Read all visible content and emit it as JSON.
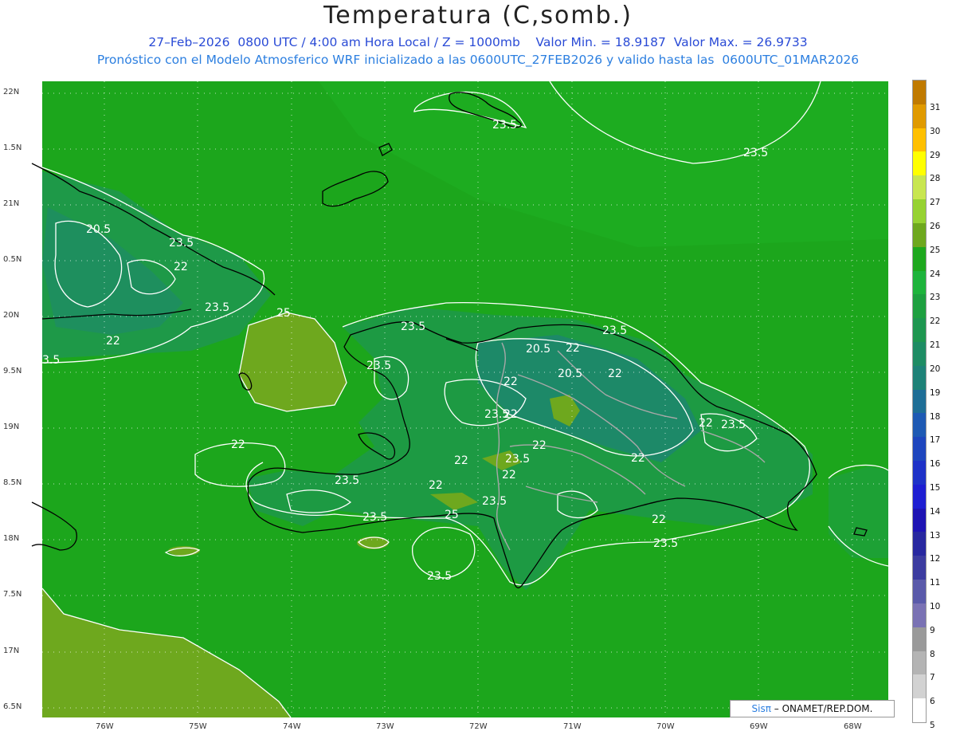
{
  "title": "Temperatura (C,somb.)",
  "subtitle1": "27–Feb–2026  0800 UTC / 4:00 am Hora Local / Z = 1000mb    Valor Min. = 18.9187  Valor Max. = 26.9733",
  "subtitle2": "Pronóstico con el Modelo Atmosferico WRF inicializado a las 0600UTC_27FEB2026 y valido hasta las  0600UTC_01MAR2026",
  "lat_labels": [
    "22N",
    "1.5N",
    "21N",
    "0.5N",
    "20N",
    "9.5N",
    "19N",
    "8.5N",
    "18N",
    "7.5N",
    "17N",
    "6.5N"
  ],
  "lon_labels": [
    "76W",
    "75W",
    "74W",
    "73W",
    "72W",
    "71W",
    "70W",
    "69W",
    "68W"
  ],
  "colorbar": {
    "levels": [
      "31",
      "30",
      "29",
      "28",
      "27",
      "26",
      "25",
      "24",
      "23",
      "22",
      "21",
      "20",
      "19",
      "18",
      "17",
      "16",
      "15",
      "14",
      "13",
      "12",
      "11",
      "10",
      "9",
      "8",
      "7",
      "6",
      "5"
    ],
    "colors": [
      "#c07a00",
      "#e09a00",
      "#ffc000",
      "#ffff00",
      "#c8e650",
      "#96d232",
      "#6ea81e",
      "#1ea81e",
      "#1eb43c",
      "#1ea040",
      "#1e9650",
      "#1e8c64",
      "#1e8278",
      "#1e6e96",
      "#1e5ab4",
      "#1e46be",
      "#1e32c8",
      "#1e1ed2",
      "#1e14b4",
      "#2828a0",
      "#3c3ca0",
      "#5a5aaa",
      "#7a72b4",
      "#9a9a9a",
      "#b4b4b4",
      "#d2d2d2",
      "#ffffff"
    ]
  },
  "contour_labels": [
    "23.5",
    "23.5",
    "20.5",
    "23.5",
    "22",
    "23.5",
    "22",
    "25",
    "3.5",
    "23.5",
    "23.5",
    "20.5",
    "22",
    "23.5",
    "20.5",
    "22",
    "22",
    "22",
    "23.5",
    "22",
    "23.5",
    "22",
    "23.5",
    "22",
    "22",
    "22",
    "23.5",
    "22",
    "23.5",
    "22",
    "23.5",
    "23.5",
    "23.5",
    "22",
    "25",
    "23.5",
    "23.5",
    "23.5"
  ],
  "credit": {
    "brand": "Sisπ",
    "text": " – ONAMET/REP.DOM."
  },
  "colors": {
    "sea": "#1ca61c",
    "warm": "#6ea81e",
    "cool": "#1e9650",
    "coast": "#000000",
    "border": "#a0a0a0",
    "contour": "#ffffff"
  }
}
